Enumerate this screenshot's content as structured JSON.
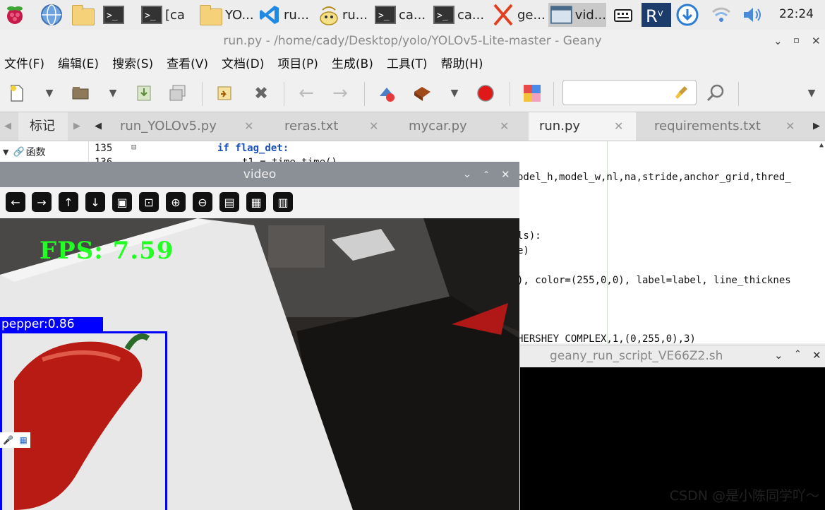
{
  "taskbar": {
    "items": [
      {
        "label": "[ca",
        "icon": "terminal-icon"
      },
      {
        "label": "YO...",
        "icon": "folder-icon"
      },
      {
        "label": "ru...",
        "icon": "vscode-icon"
      },
      {
        "label": "ru...",
        "icon": "python-icon"
      },
      {
        "label": "ca...",
        "icon": "terminal-icon"
      },
      {
        "label": "ca...",
        "icon": "terminal-icon"
      },
      {
        "label": "ge...",
        "icon": "geany-icon"
      },
      {
        "label": "vid...",
        "icon": "video-window-icon"
      }
    ],
    "clock": "22:24"
  },
  "window": {
    "title": "run.py - /home/cady/Desktop/yolo/YOLOv5-Lite-master - Geany"
  },
  "menu": [
    "文件(F)",
    "编辑(E)",
    "搜索(S)",
    "查看(V)",
    "文档(D)",
    "项目(P)",
    "生成(B)",
    "工具(T)",
    "帮助(H)"
  ],
  "sidebar": {
    "tab_label": "标记",
    "tree_item": "函数"
  },
  "tabs": [
    {
      "label": "run_YOLOv5.py",
      "active": false
    },
    {
      "label": "reras.txt",
      "active": false
    },
    {
      "label": "mycar.py",
      "active": false
    },
    {
      "label": "run.py",
      "active": true
    },
    {
      "label": "requirements.txt",
      "active": false
    }
  ],
  "editor": {
    "line_135_num": "135",
    "line_135": "if flag_det:",
    "line_136_num": "136",
    "line_136": "t1 = time.time()",
    "frag_1": "odel_h,model_w,nl,na,stride,anchor_grid,thred_",
    "frag_2": "ls):",
    "frag_3": "e)",
    "frag_4": "), color=(255,0,0), label=label, line_thicknes",
    "frag_5": "HERSHEY_COMPLEX,1,(0,255,0),3)"
  },
  "terminal": {
    "title": "geany_run_script_VE66Z2.sh"
  },
  "video_window": {
    "title": "video",
    "fps_text": "FPS: 7.59",
    "detection_label": "pepper:0.86",
    "detection_score": 0.86
  },
  "watermark": "CSDN @是小陈同学吖～",
  "colors": {
    "fps_text": "#22ff22",
    "detection_box": "#0000ff"
  }
}
